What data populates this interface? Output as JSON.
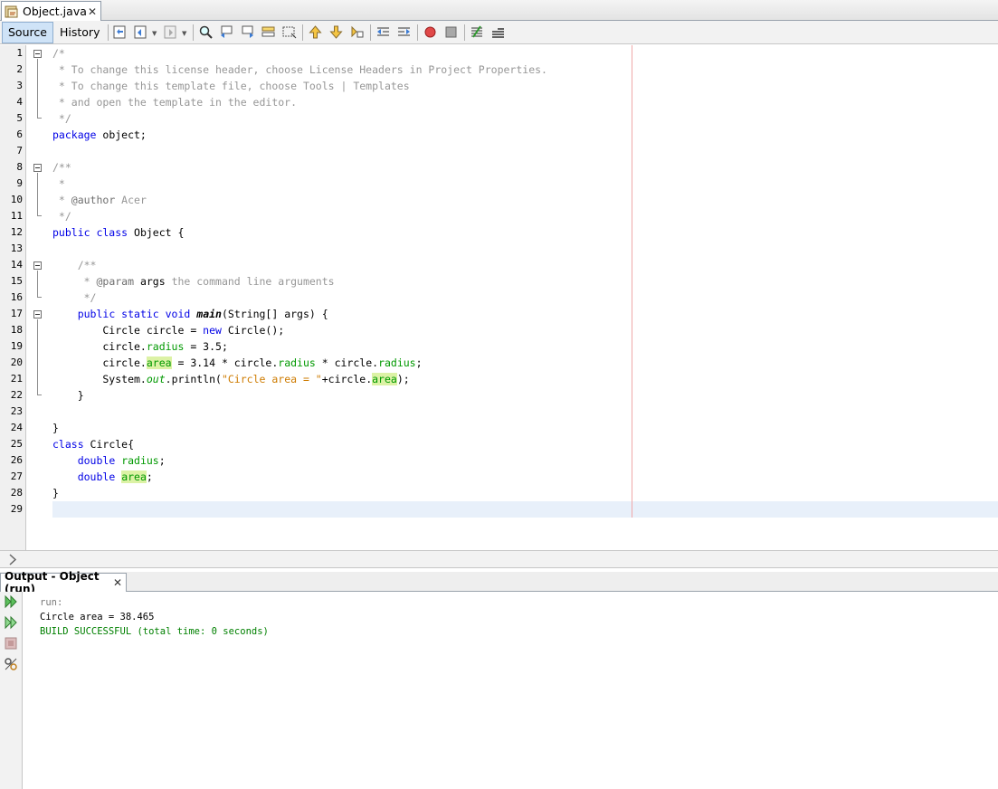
{
  "editor_tab": {
    "title": "Object.java",
    "close": "✕"
  },
  "toolbar": {
    "source_label": "Source",
    "history_label": "History"
  },
  "code": {
    "line_numbers": [
      "1",
      "2",
      "3",
      "4",
      "5",
      "6",
      "7",
      "8",
      "9",
      "10",
      "11",
      "12",
      "13",
      "14",
      "15",
      "16",
      "17",
      "18",
      "19",
      "20",
      "21",
      "22",
      "23",
      "24",
      "25",
      "26",
      "27",
      "28",
      "29"
    ],
    "l1": "/*",
    "l2": " * To change this license header, choose License Headers in Project Properties.",
    "l3": " * To change this template file, choose Tools | Templates",
    "l4": " * and open the template in the editor.",
    "l5": " */",
    "l6_kw": "package",
    "l6_rest": " object;",
    "l8": "/**",
    "l9": " *",
    "l10_a": " * ",
    "l10_tag": "@author",
    "l10_b": " Acer",
    "l11": " */",
    "l12_kw": "public class",
    "l12_rest": " Object {",
    "l14": "    /**",
    "l15_a": "     * ",
    "l15_tag": "@param",
    "l15_arg": " args",
    "l15_b": " the command line arguments",
    "l16": "     */",
    "l17_ind": "    ",
    "l17_kw": "public static void",
    "l17_sp": " ",
    "l17_m": "main",
    "l17_rest": "(String[] args) {",
    "l18_a": "        Circle circle = ",
    "l18_kw": "new",
    "l18_b": " Circle();",
    "l19_a": "        circle.",
    "l19_f": "radius",
    "l19_b": " = 3.5;",
    "l20_a": "        circle.",
    "l20_f1": "area",
    "l20_b": " = 3.14 * circle.",
    "l20_f2": "radius",
    "l20_c": " * circle.",
    "l20_f3": "radius",
    "l20_d": ";",
    "l21_a": "        System.",
    "l21_out": "out",
    "l21_b": ".println(",
    "l21_str": "\"Circle area = \"",
    "l21_c": "+circle.",
    "l21_f": "area",
    "l21_d": ");",
    "l22": "    }",
    "l24": "}",
    "l25_kw": "class",
    "l25_rest": " Circle{",
    "l26_ind": "    ",
    "l26_kw": "double",
    "l26_sp": " ",
    "l26_f": "radius",
    "l26_end": ";",
    "l27_ind": "    ",
    "l27_kw": "double",
    "l27_sp": " ",
    "l27_f": "area",
    "l27_end": ";",
    "l28": "}"
  },
  "output": {
    "tab_title": "Output - Object (run)",
    "close": "✕",
    "lines": [
      "run:",
      "Circle area = 38.465",
      "BUILD SUCCESSFUL (total time: 0 seconds)"
    ],
    "colors": {
      "run": "#7a7a7a",
      "normal": "#000000",
      "success": "#008000"
    }
  },
  "colors": {
    "keyword": "#0000e6",
    "field": "#009900",
    "string": "#ce7b00",
    "comment": "#969696",
    "highlight": "#dcf2a5"
  }
}
